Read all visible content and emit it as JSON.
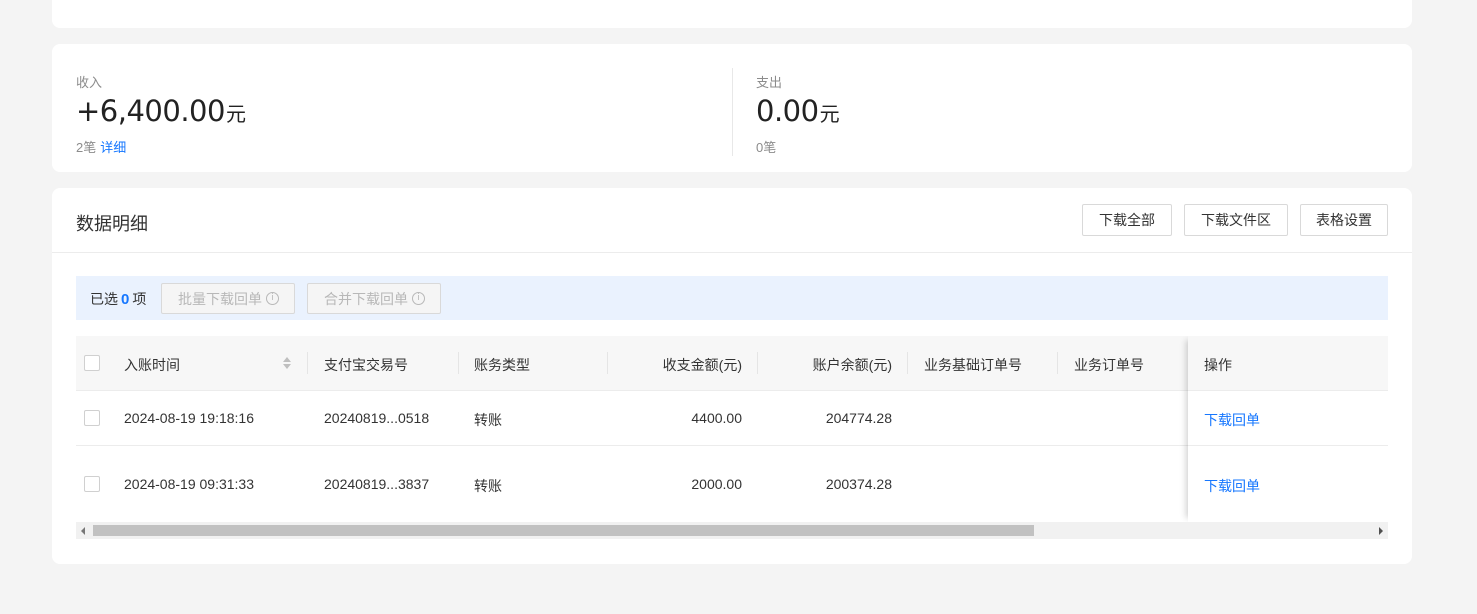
{
  "summary": {
    "income": {
      "label": "收入",
      "amount": "+6,400.00",
      "unit": "元",
      "count": "2笔",
      "detail_link": "详细"
    },
    "expense": {
      "label": "支出",
      "amount": "0.00",
      "unit": "元",
      "count": "0笔"
    }
  },
  "detail": {
    "title": "数据明细",
    "buttons": {
      "download_all": "下载全部",
      "download_area": "下载文件区",
      "table_settings": "表格设置"
    },
    "selection": {
      "prefix": "已选",
      "count": "0",
      "suffix": "项",
      "batch_download": "批量下载回单",
      "merge_download": "合并下载回单",
      "info_icon": "info-circle-icon"
    }
  },
  "table": {
    "columns": [
      "入账时间",
      "支付宝交易号",
      "账务类型",
      "收支金额(元)",
      "账户余额(元)",
      "业务基础订单号",
      "业务订单号",
      "操作"
    ],
    "rows": [
      {
        "time": "2024-08-19 19:18:16",
        "trade_no": "20240819...0518",
        "type": "转账",
        "amount": "4400.00",
        "balance": "204774.28",
        "base_order": "",
        "order": "",
        "action": "下载回单"
      },
      {
        "time": "2024-08-19 09:31:33",
        "trade_no": "20240819...3837",
        "type": "转账",
        "amount": "2000.00",
        "balance": "200374.28",
        "base_order": "",
        "order": "",
        "action": "下载回单"
      }
    ]
  },
  "colors": {
    "accent": "#1677ff",
    "page_bg": "#f4f4f4",
    "select_bar_bg": "#eaf2fe"
  }
}
